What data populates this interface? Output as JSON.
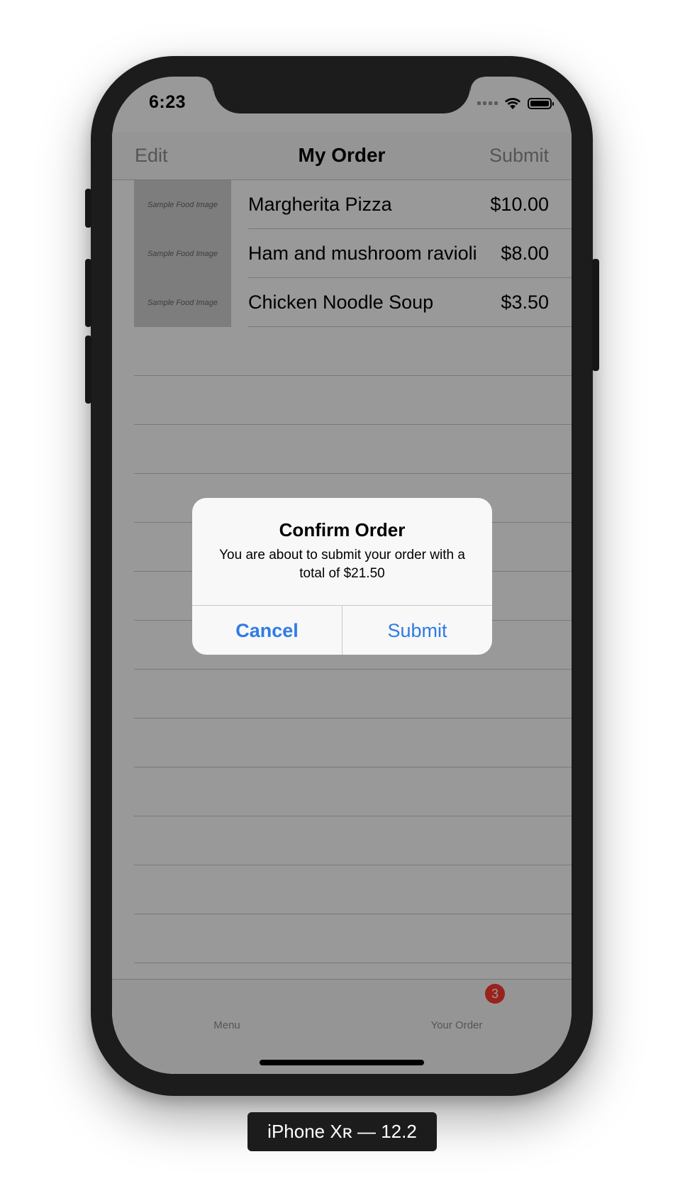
{
  "status_bar": {
    "time": "6:23"
  },
  "navbar": {
    "left_label": "Edit",
    "title": "My Order",
    "right_label": "Submit"
  },
  "order_items": [
    {
      "image_label": "Sample Food Image",
      "name": "Margherita Pizza",
      "price": "$10.00"
    },
    {
      "image_label": "Sample Food Image",
      "name": "Ham and mushroom ravioli",
      "price": "$8.00"
    },
    {
      "image_label": "Sample Food Image",
      "name": "Chicken Noodle Soup",
      "price": "$3.50"
    }
  ],
  "alert": {
    "title": "Confirm Order",
    "message": "You are about to submit your order with a total of $21.50",
    "cancel_label": "Cancel",
    "submit_label": "Submit"
  },
  "tabbar": {
    "tabs": [
      {
        "label": "Menu"
      },
      {
        "label": "Your Order",
        "badge": "3"
      }
    ]
  },
  "device_caption": "iPhone Xʀ — 12.2",
  "colors": {
    "tint_blue": "#2f7be6",
    "badge_red": "#ff3b30",
    "separator": "#c8c7cc"
  }
}
